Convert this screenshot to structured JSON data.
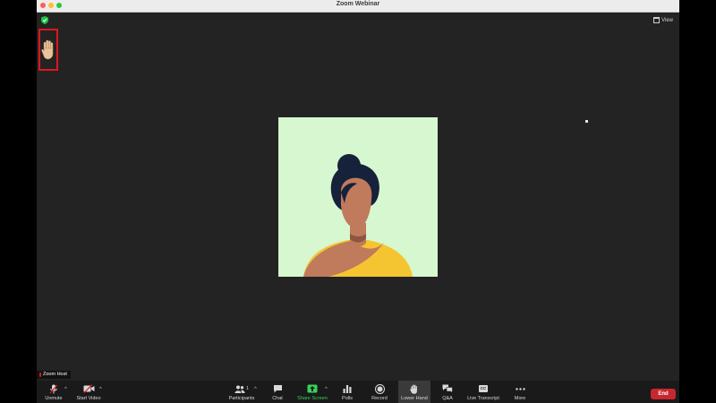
{
  "window": {
    "title": "Zoom Webinar"
  },
  "top_right": {
    "view_label": "View"
  },
  "name_label": "Zoom Host",
  "toolbar": {
    "unmute": "Unmute",
    "start_video": "Start Video",
    "participants": "Participants",
    "participants_count": "1",
    "chat": "Chat",
    "share_screen": "Share Screen",
    "polls": "Polls",
    "record": "Record",
    "lower_hand": "Lower Hand",
    "qa": "Q&A",
    "live_transcript": "Live Transcript",
    "cc_badge": "CC",
    "more": "More",
    "end": "End"
  },
  "icons": {
    "shield": "shield-check-icon",
    "raised_hand": "raised-hand-icon",
    "unmute": "microphone-muted-icon",
    "start_video": "camera-off-icon",
    "participants": "people-icon",
    "chat": "chat-bubble-icon",
    "share_screen": "share-arrow-icon",
    "polls": "bar-chart-icon",
    "record": "record-icon",
    "lower_hand": "hand-icon",
    "qa": "qa-bubbles-icon",
    "live_transcript": "cc-icon",
    "more": "ellipsis-icon"
  },
  "colors": {
    "window_bg": "#232323",
    "toolbar_bg": "#1a1a1a",
    "accent_green": "#37d15a",
    "end_red": "#c7272d",
    "highlight_red": "#e0161c",
    "tile_bg": "#d6f7cf"
  }
}
